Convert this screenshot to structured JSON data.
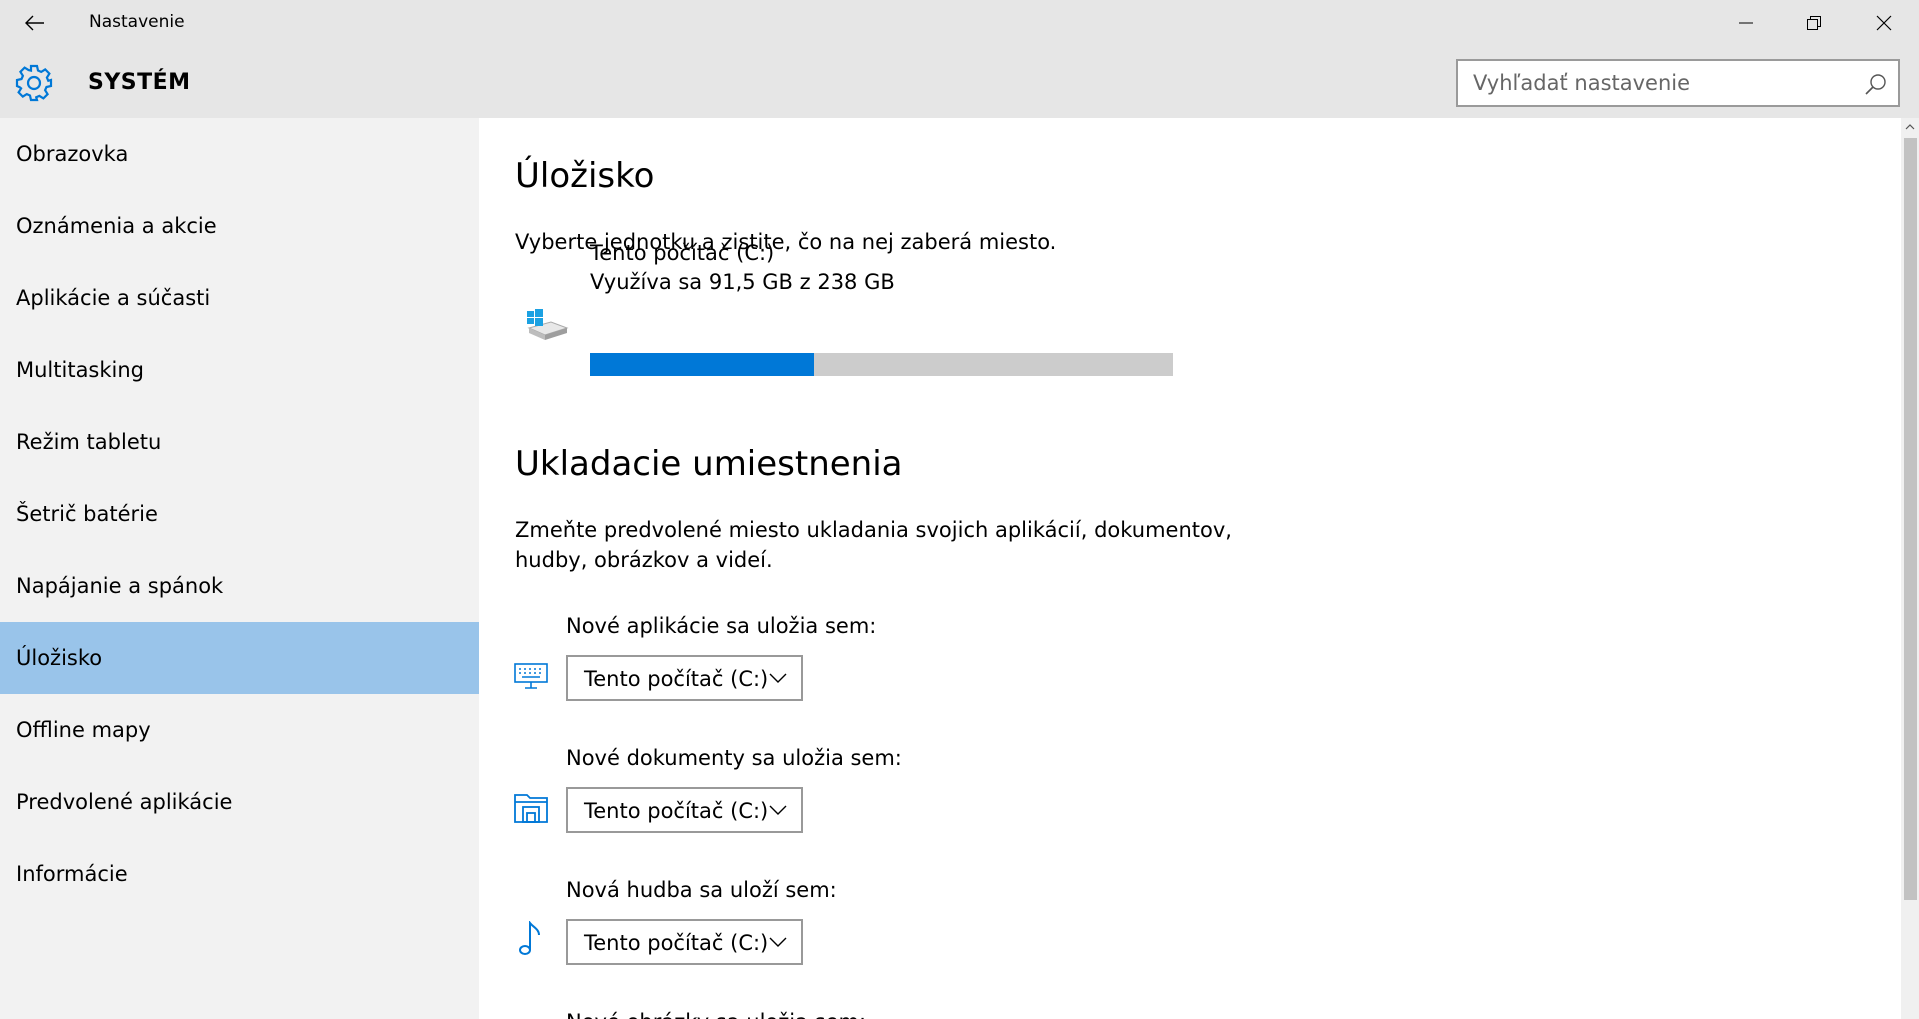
{
  "window": {
    "title": "Nastavenie",
    "back_icon": "back-arrow-icon",
    "minimize_icon": "minimize-icon",
    "restore_icon": "restore-icon",
    "close_icon": "close-icon"
  },
  "header": {
    "icon": "gear-icon",
    "title": "SYSTÉM",
    "search_placeholder": "Vyhľadať nastavenie",
    "search_icon": "search-icon"
  },
  "colors": {
    "accent": "#0078d7",
    "selected_nav": "#99c4ea",
    "chrome_bg": "#e6e6e6",
    "sidebar_bg": "#f2f2f2",
    "bar_track": "#cccccc"
  },
  "sidebar": {
    "items": [
      {
        "label": "Obrazovka"
      },
      {
        "label": "Oznámenia a akcie"
      },
      {
        "label": "Aplikácie a súčasti"
      },
      {
        "label": "Multitasking"
      },
      {
        "label": "Režim tabletu"
      },
      {
        "label": "Šetrič batérie"
      },
      {
        "label": "Napájanie a spánok"
      },
      {
        "label": "Úložisko",
        "selected": true
      },
      {
        "label": "Offline mapy"
      },
      {
        "label": "Predvolené aplikácie"
      },
      {
        "label": "Informácie"
      }
    ]
  },
  "main": {
    "storage_heading": "Úložisko",
    "storage_desc": "Vyberte jednotku a zistite, čo na nej zaberá miesto.",
    "drive": {
      "icon": "windows-drive-icon",
      "name": "Tento počítač (C:)",
      "usage": "Využíva sa 91,5 GB z 238 GB",
      "used_fraction": 0.384
    },
    "locations_heading": "Ukladacie umiestnenia",
    "locations_desc_line1": "Zmeňte predvolené miesto ukladania svojich aplikácií, dokumentov,",
    "locations_desc_line2": "hudby, obrázkov a videí.",
    "locations": [
      {
        "label": "Nové aplikácie sa uložia sem:",
        "value": "Tento počítač (C:)",
        "icon": "keyboard-icon"
      },
      {
        "label": "Nové dokumenty sa uložia sem:",
        "value": "Tento počítač (C:)",
        "icon": "documents-folder-icon"
      },
      {
        "label": "Nová hudba sa uloží sem:",
        "value": "Tento počítač (C:)",
        "icon": "music-note-icon"
      },
      {
        "label": "Nové obrázky sa uložia sem:"
      }
    ]
  }
}
